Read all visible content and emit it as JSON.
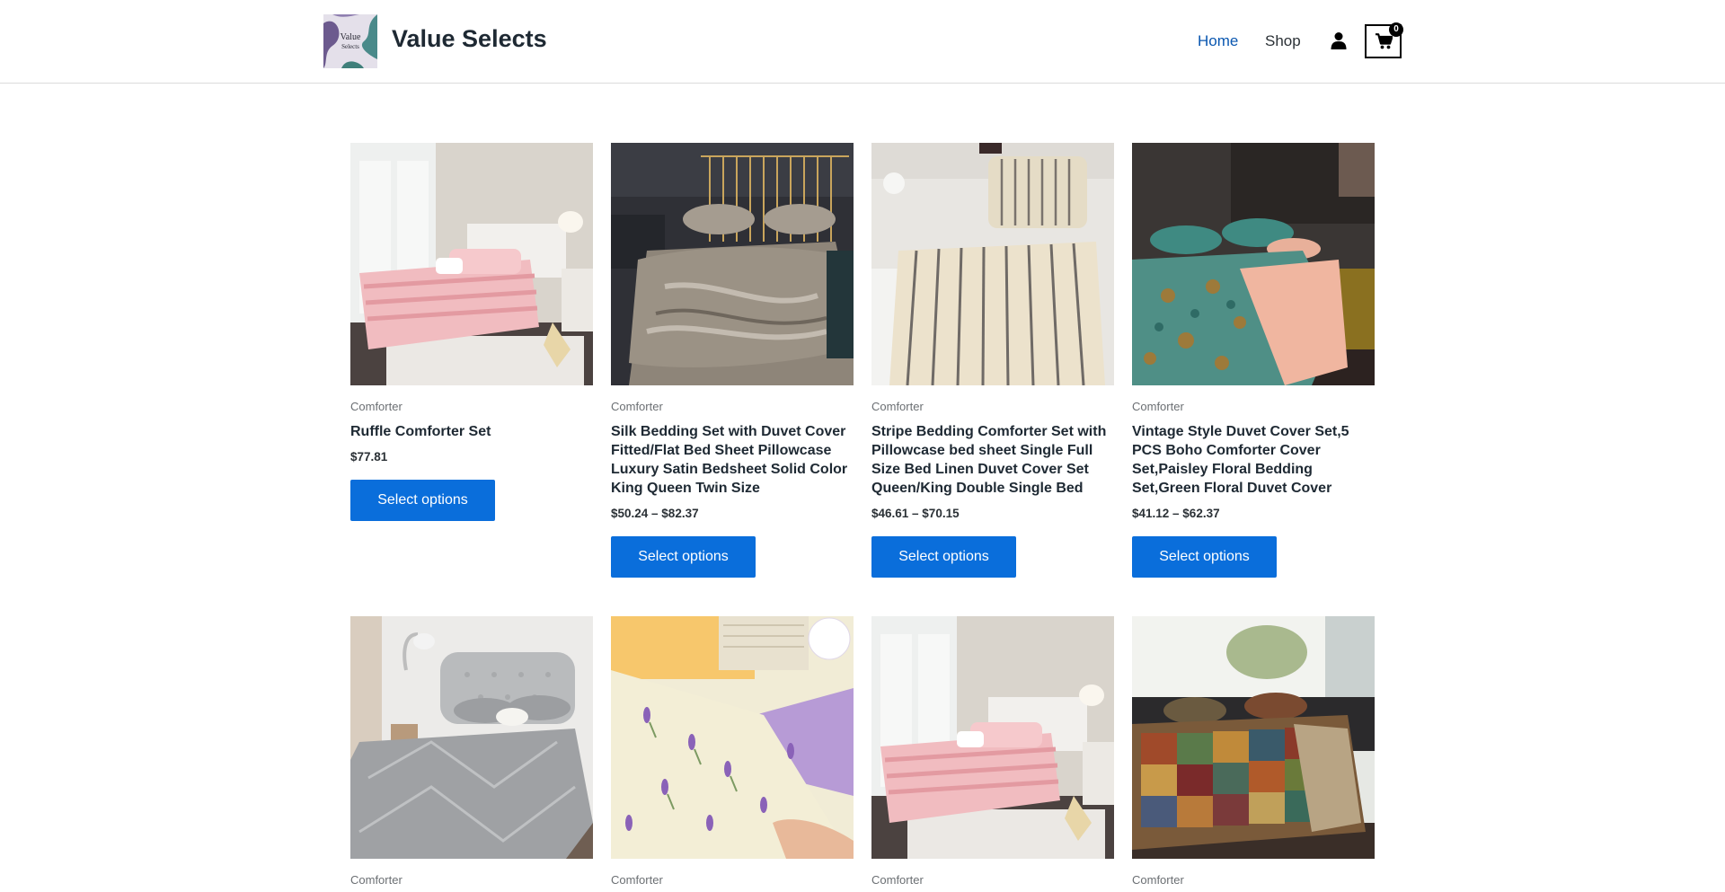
{
  "site": {
    "title": "Value Selects",
    "logo_text_top": "Value",
    "logo_text_bottom": "Selects"
  },
  "nav": {
    "home": "Home",
    "shop": "Shop",
    "cart_count": "0"
  },
  "colors": {
    "accent": "#0a6edb",
    "nav_active": "#0a57b0",
    "text": "#1e2933"
  },
  "products": [
    {
      "category": "Comforter",
      "name": "Ruffle Comforter Set",
      "price": "$77.81",
      "button": "Select options"
    },
    {
      "category": "Comforter",
      "name": "Silk Bedding Set with Duvet Cover Fitted/Flat Bed Sheet Pillowcase Luxury Satin Bedsheet Solid Color King Queen Twin Size",
      "price": "$50.24 – $82.37",
      "button": "Select options"
    },
    {
      "category": "Comforter",
      "name": "Stripe Bedding Comforter Set with Pillowcase bed sheet Single Full Size Bed Linen Duvet Cover Set Queen/King Double Single Bed",
      "price": "$46.61 – $70.15",
      "button": "Select options"
    },
    {
      "category": "Comforter",
      "name": "Vintage Style Duvet Cover Set,5 PCS Boho Comforter Cover Set,Paisley Floral Bedding Set,Green Floral Duvet Cover",
      "price": "$41.12 – $62.37",
      "button": "Select options"
    },
    {
      "category": "Comforter"
    },
    {
      "category": "Comforter"
    },
    {
      "category": "Comforter"
    },
    {
      "category": "Comforter"
    }
  ]
}
